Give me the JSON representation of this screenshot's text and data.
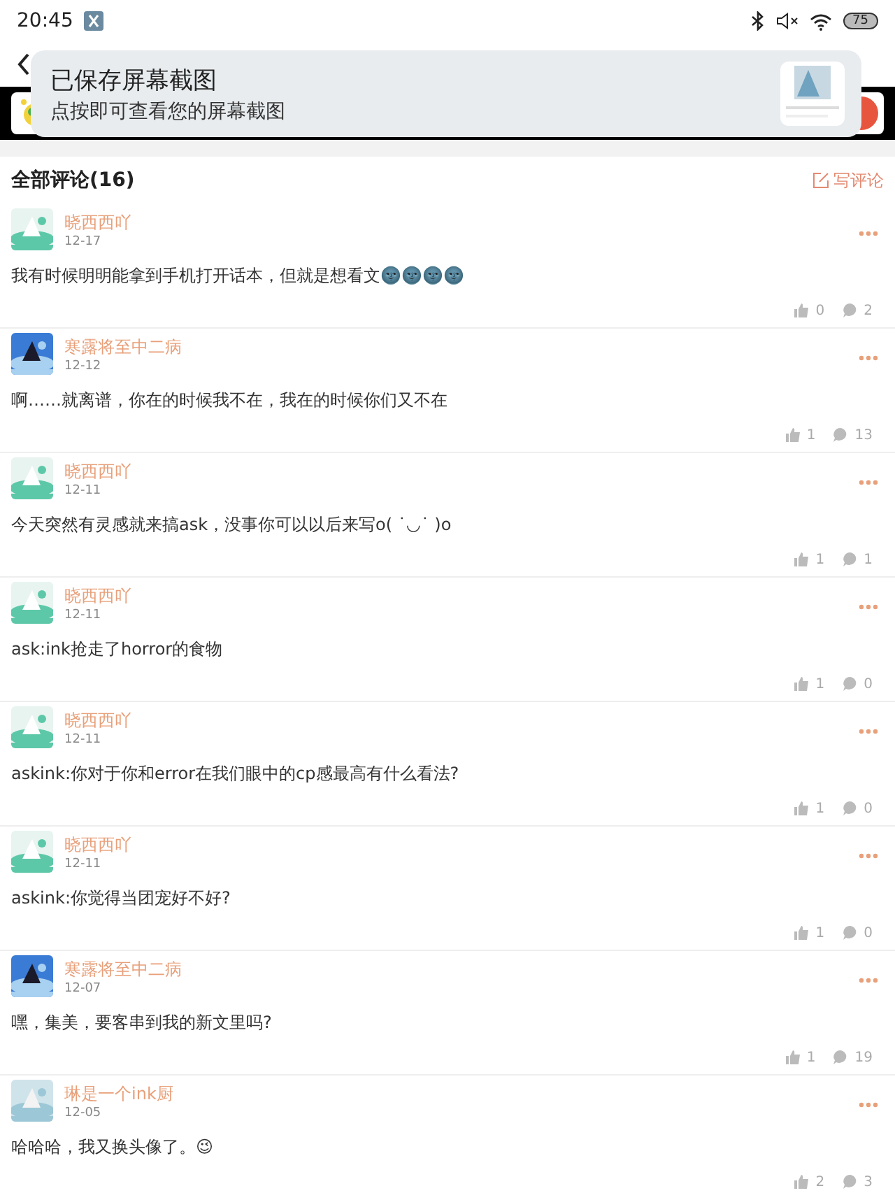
{
  "status_bar": {
    "time": "20:45",
    "battery": "75"
  },
  "notification": {
    "title": "已保存屏幕截图",
    "subtitle": "点按即可查看您的屏幕截图"
  },
  "comments_header": {
    "title": "全部评论(16)",
    "write_label": "写评论"
  },
  "comments": [
    {
      "author": "晓西西吖",
      "date": "12-17",
      "text": "我有时候明明能拿到手机打开话本，但就是想看文🌚🌚🌚🌚",
      "likes": "0",
      "replies": "2"
    },
    {
      "author": "寒露将至中二病",
      "date": "12-12",
      "text": "啊……就离谱，你在的时候我不在，我在的时候你们又不在",
      "likes": "1",
      "replies": "13"
    },
    {
      "author": "晓西西吖",
      "date": "12-11",
      "text": "今天突然有灵感就来搞ask，没事你可以以后来写o( ˙◡˙ )o",
      "likes": "1",
      "replies": "1"
    },
    {
      "author": "晓西西吖",
      "date": "12-11",
      "text": "ask:ink抢走了horror的食物",
      "likes": "1",
      "replies": "0"
    },
    {
      "author": "晓西西吖",
      "date": "12-11",
      "text": "askink:你对于你和error在我们眼中的cp感最高有什么看法?",
      "likes": "1",
      "replies": "0"
    },
    {
      "author": "晓西西吖",
      "date": "12-11",
      "text": "askink:你觉得当团宠好不好?",
      "likes": "1",
      "replies": "0"
    },
    {
      "author": "寒露将至中二病",
      "date": "12-07",
      "text": "嘿，集美，要客串到我的新文里吗?",
      "likes": "1",
      "replies": "19"
    },
    {
      "author": "琳是一个ink厨",
      "date": "12-05",
      "text": "哈哈哈，我又换头像了。😉",
      "likes": "2",
      "replies": "3"
    }
  ]
}
